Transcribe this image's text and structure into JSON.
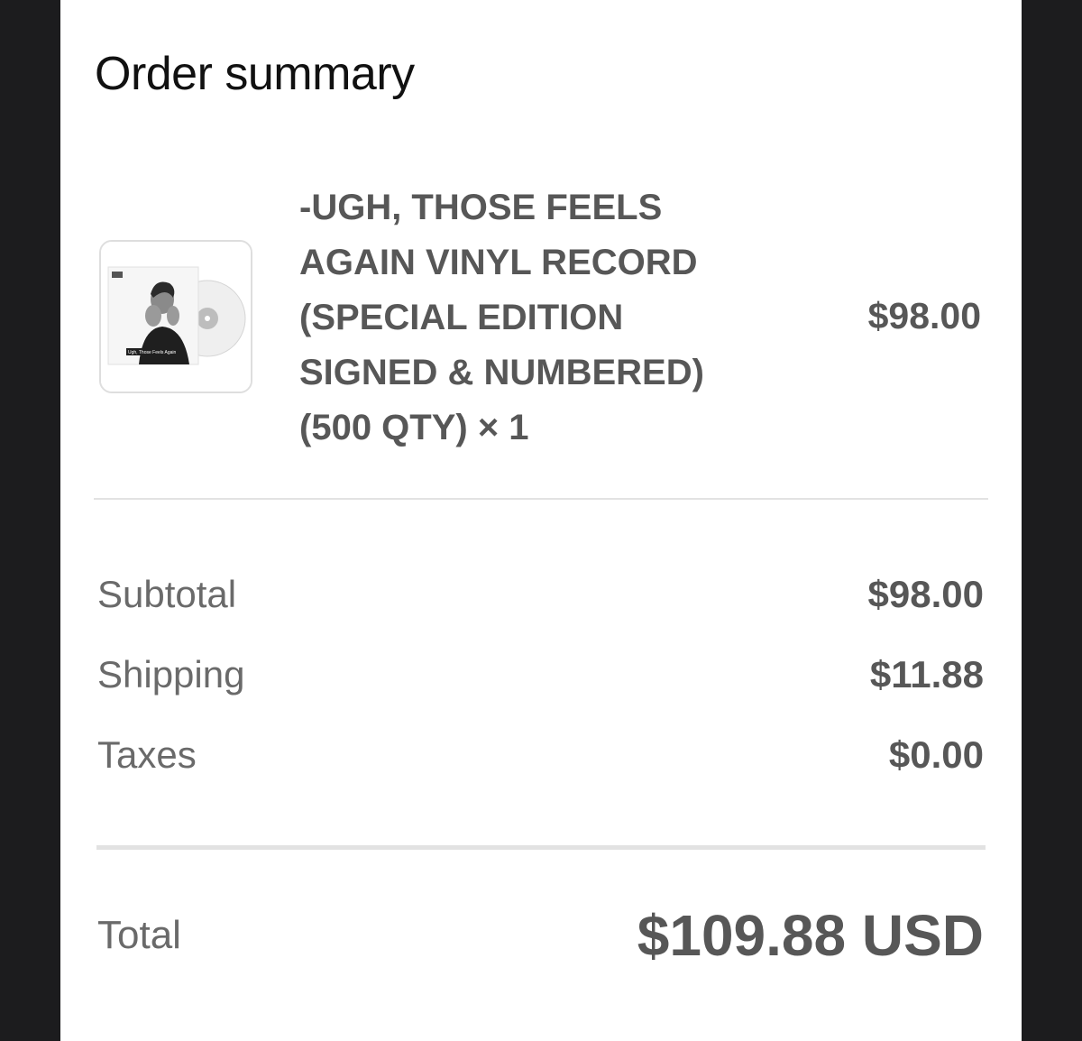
{
  "title": "Order summary",
  "item": {
    "name": "-UGH, THOSE FEELS AGAIN VINYL RECORD (SPECIAL EDITION SIGNED & NUMBERED) (500 QTY) × 1",
    "price": "$98.00",
    "cover_text": "Ugh, Those Feels Again"
  },
  "summary": {
    "subtotal_label": "Subtotal",
    "subtotal_value": "$98.00",
    "shipping_label": "Shipping",
    "shipping_value": "$11.88",
    "taxes_label": "Taxes",
    "taxes_value": "$0.00"
  },
  "total": {
    "label": "Total",
    "value": "$109.88 USD"
  }
}
